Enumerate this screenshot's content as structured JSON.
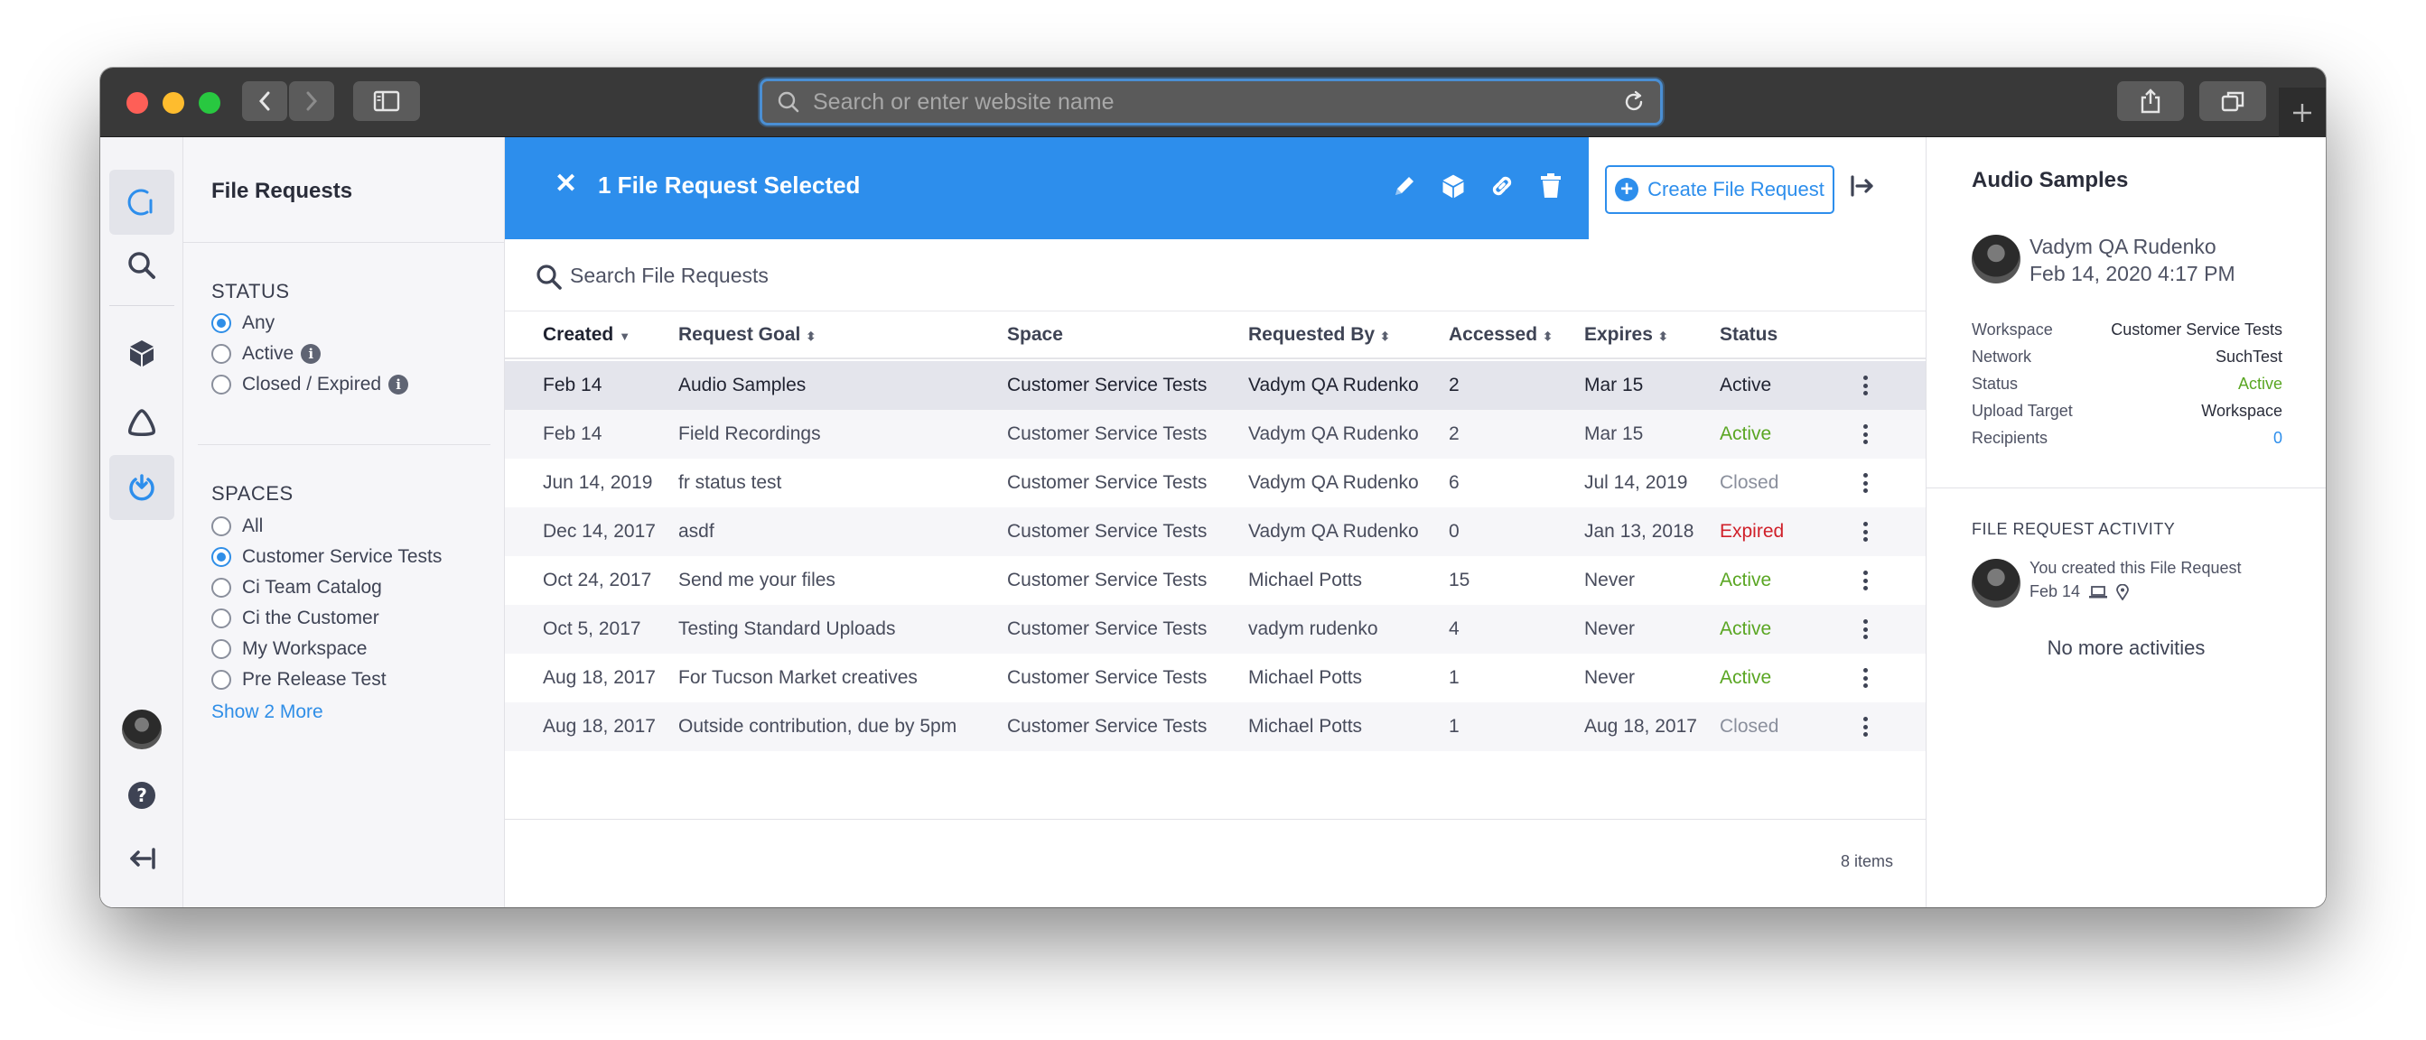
{
  "browser": {
    "address_placeholder": "Search or enter website name"
  },
  "filters": {
    "title": "File Requests",
    "status_title": "STATUS",
    "status_options": [
      "Any",
      "Active",
      "Closed / Expired"
    ],
    "status_selected": "Any",
    "spaces_title": "SPACES",
    "space_options": [
      "All",
      "Customer Service Tests",
      "Ci Team Catalog",
      "Ci the Customer",
      "My Workspace",
      "Pre Release Test"
    ],
    "space_selected": "Customer Service Tests",
    "show_more": "Show 2 More"
  },
  "selection_bar": {
    "title": "1 File Request Selected",
    "close_label": "✕",
    "create_button": "Create File Request",
    "accent_color": "#2d8eec"
  },
  "search": {
    "placeholder": "Search File Requests"
  },
  "table": {
    "columns": [
      "Created",
      "Request Goal",
      "Space",
      "Requested By",
      "Accessed",
      "Expires",
      "Status"
    ],
    "rows": [
      [
        "Feb 14",
        "Audio Samples",
        "Customer Service Tests",
        "Vadym QA Rudenko",
        "2",
        "Mar 15",
        "Active"
      ],
      [
        "Feb 14",
        "Field Recordings",
        "Customer Service Tests",
        "Vadym QA Rudenko",
        "2",
        "Mar 15",
        "Active"
      ],
      [
        "Jun 14, 2019",
        "fr status test",
        "Customer Service Tests",
        "Vadym QA Rudenko",
        "6",
        "Jul 14, 2019",
        "Closed"
      ],
      [
        "Dec 14, 2017",
        "asdf",
        "Customer Service Tests",
        "Vadym QA Rudenko",
        "0",
        "Jan 13, 2018",
        "Expired"
      ],
      [
        "Oct 24, 2017",
        "Send me your files",
        "Customer Service Tests",
        "Michael Potts",
        "15",
        "Never",
        "Active"
      ],
      [
        "Oct 5, 2017",
        "Testing Standard Uploads",
        "Customer Service Tests",
        "vadym rudenko",
        "4",
        "Never",
        "Active"
      ],
      [
        "Aug 18, 2017",
        "For Tucson Market creatives",
        "Customer Service Tests",
        "Michael Potts",
        "1",
        "Never",
        "Active"
      ],
      [
        "Aug 18, 2017",
        "Outside contribution, due by 5pm",
        "Customer Service Tests",
        "Michael Potts",
        "1",
        "Aug 18, 2017",
        "Closed"
      ]
    ],
    "status_colors": {
      "Active": "#5aa623",
      "Closed": "#8a8f9c",
      "Expired": "#d0202a"
    },
    "count": "8 items"
  },
  "detail": {
    "title": "Audio Samples",
    "owner_name": "Vadym QA Rudenko",
    "owner_date": "Feb 14, 2020 4:17 PM",
    "fields": [
      {
        "key": "Workspace",
        "value": "Customer Service Tests"
      },
      {
        "key": "Network",
        "value": "SuchTest"
      },
      {
        "key": "Status",
        "value": "Active"
      },
      {
        "key": "Upload Target",
        "value": "Workspace"
      },
      {
        "key": "Recipients",
        "value": "0"
      }
    ],
    "activity_title": "FILE REQUEST ACTIVITY",
    "activity_text": "You created this File Request",
    "activity_date": "Feb 14",
    "no_more": "No more activities"
  }
}
